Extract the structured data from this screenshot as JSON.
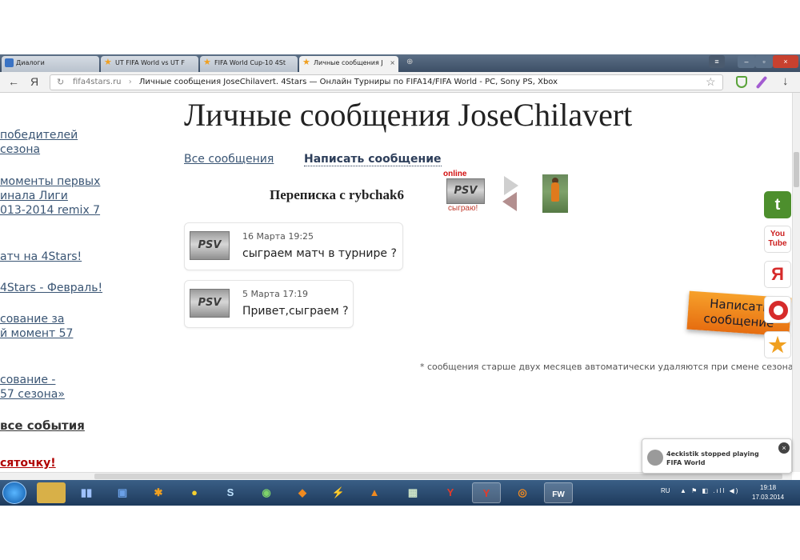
{
  "browser": {
    "tabs": [
      {
        "label": "Диалоги",
        "active": false
      },
      {
        "label": "UT FIFA World vs UT F",
        "active": false
      },
      {
        "label": "FIFA World Cup-10 4St",
        "active": false
      },
      {
        "label": "Личные сообщения J",
        "active": true
      }
    ],
    "address": {
      "domain": "fifa4stars.ru",
      "separator": "›",
      "page_title": "Личные сообщения JoseChilavert. 4Stars — Онлайн Турниры по FIFA14/FIFA World - PC, Sony PS, Xbox"
    },
    "back_icon": "←",
    "yandex_letter": "Я",
    "refresh_icon": "↻",
    "star_icon": "☆",
    "download_icon": "↓"
  },
  "sidebar": {
    "links": [
      {
        "lines": [
          "победителей",
          "сезона"
        ]
      },
      {
        "lines": [
          "моменты первых",
          "инала Лиги",
          "013-2014 remix 7"
        ]
      },
      {
        "lines": [
          "атч на 4Stars!"
        ]
      },
      {
        "lines": [
          "4Stars - Февраль!"
        ]
      },
      {
        "lines": [
          "сование за",
          "й момент 57"
        ]
      },
      {
        "lines": [
          "сование -",
          "57 сезона»"
        ]
      },
      {
        "lines": [
          "все события"
        ]
      },
      {
        "lines": [
          "сяточку!"
        ]
      }
    ]
  },
  "main": {
    "title": "Личные сообщения JoseChilavert",
    "all_messages_label": "Все сообщения",
    "write_message_label": "Написать сообщение",
    "conversation_title": "Переписка с rybchak6",
    "online_label": "online",
    "avatar_text": "PSV",
    "play_label": "сыграю!",
    "messages": [
      {
        "date": "16 Марта 19:25",
        "text": "сыграем матч в турнире ?",
        "avatar": "PSV"
      },
      {
        "date": "5 Марта 17:19",
        "text": "Привет,сыграем ?",
        "avatar": "PSV"
      }
    ],
    "note": "* сообщения старше двух месяцев автоматически удаляются при смене сезона",
    "write_button": {
      "line1": "Написать",
      "line2": "сообщение"
    }
  },
  "social": {
    "twitter": "t",
    "youtube": "You Tube",
    "yandex": "Я",
    "lifebuoy": "",
    "fourstars": "4"
  },
  "notification": {
    "text": "4eckistik stopped playing FIFA World",
    "close": "×"
  },
  "taskbar": {
    "pinned": [
      "explorer",
      "media",
      "vlc-like",
      "tools",
      "camera",
      "skype",
      "chrome",
      "games",
      "flash",
      "vlc",
      "network",
      "yandex",
      "yandex-active",
      "radio",
      "fifa-world"
    ],
    "fw_label": "FW",
    "tray_lang": "RU",
    "tray_icons": "▲ ⚑ ◧ .ıll ◀)",
    "clock_time": "19:18",
    "clock_date": "17.03.2014"
  },
  "colors": {
    "link": "#3a5574",
    "online": "#d20f0f",
    "write_button": "#f08a20",
    "twitter": "#4d8f2d",
    "youtube": "#cc1f1f",
    "yandex": "#d62b2b"
  }
}
